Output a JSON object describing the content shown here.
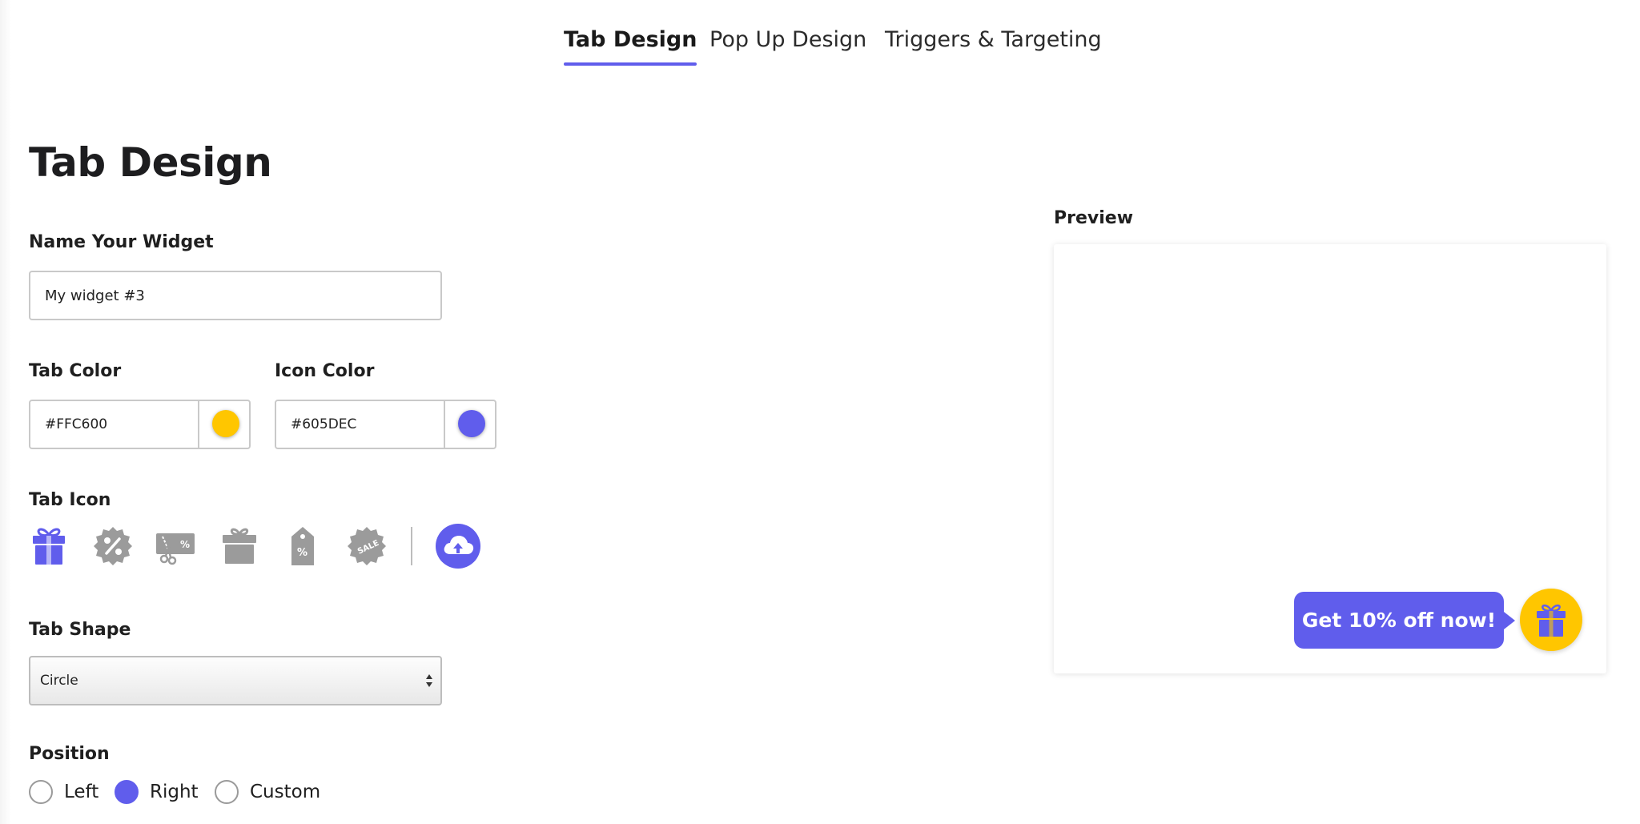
{
  "tabs": [
    {
      "label": "Tab Design",
      "active": true
    },
    {
      "label": "Pop Up Design",
      "active": false
    },
    {
      "label": "Triggers & Targeting",
      "active": false
    }
  ],
  "page_title": "Tab Design",
  "widget_name": {
    "label": "Name Your Widget",
    "value": "My widget #3"
  },
  "tab_color": {
    "label": "Tab Color",
    "value": "#FFC600"
  },
  "icon_color": {
    "label": "Icon Color",
    "value": "#605DEC"
  },
  "tab_icon": {
    "label": "Tab Icon",
    "icons": [
      "gift-icon",
      "percent-badge-icon",
      "coupon-scissors-icon",
      "gift-box-icon",
      "price-tag-icon",
      "sale-badge-icon"
    ],
    "selected": "gift-icon",
    "upload_icon": "cloud-upload-icon"
  },
  "tab_shape": {
    "label": "Tab Shape",
    "selected": "Circle"
  },
  "position": {
    "label": "Position",
    "options": [
      "Left",
      "Right",
      "Custom"
    ],
    "selected": "Right"
  },
  "preview": {
    "label": "Preview",
    "callout_text": "Get 10% off now!"
  },
  "colors": {
    "accent": "#605DEC",
    "tab": "#FFC600",
    "icon_inactive": "#9b9b9b"
  }
}
